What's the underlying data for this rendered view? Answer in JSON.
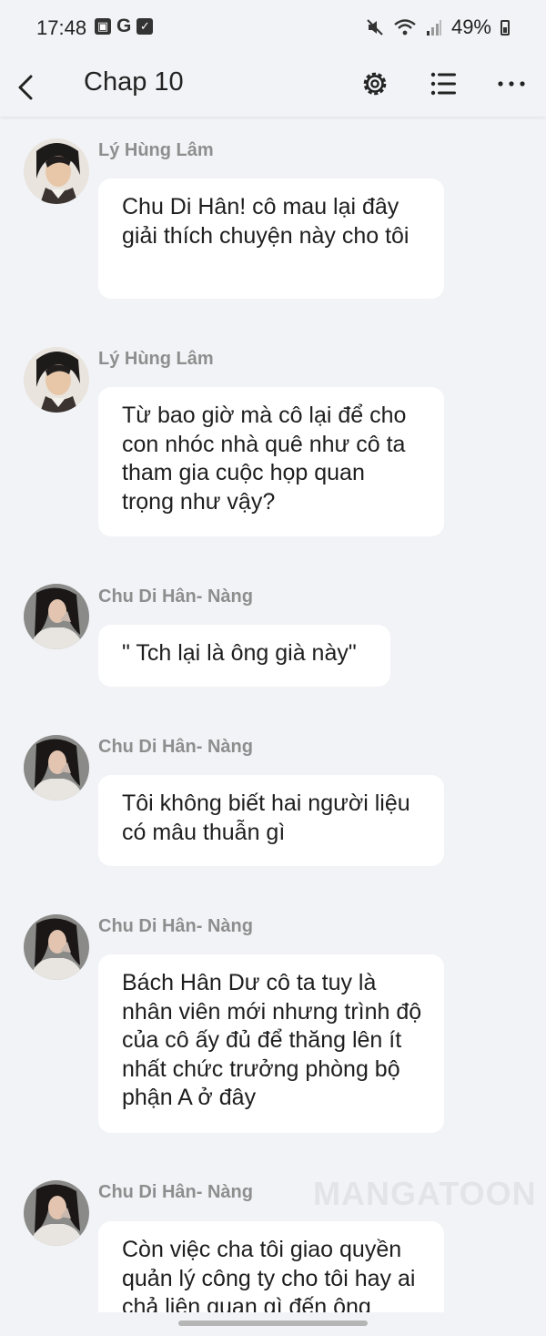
{
  "status_bar": {
    "time": "17:48",
    "app_icon_g": "G",
    "battery": "49%"
  },
  "header": {
    "title": "Chap 10",
    "icons": [
      "back-arrow-icon",
      "gear-icon",
      "list-icon",
      "more-icon"
    ]
  },
  "messages": [
    {
      "name": "Lý Hùng Lâm",
      "text": "Chu Di Hân! cô mau lại đây giải thích chuyện này cho tôi"
    },
    {
      "name": "Lý Hùng Lâm",
      "text": "Từ bao giờ mà cô lại để cho con nhóc nhà quê như cô ta tham gia cuộc họp quan trọng như vậy?"
    },
    {
      "name": "Chu Di Hân- Nàng",
      "text": "\" Tch lại là ông già này\""
    },
    {
      "name": "Chu Di Hân- Nàng",
      "text": "Tôi không biết hai người liệu có mâu thuẫn gì"
    },
    {
      "name": "Chu Di Hân- Nàng",
      "text": "Bách Hân Dư cô ta tuy là nhân viên mới nhưng trình độ của cô ấy đủ để thăng lên ít nhất chức trưởng phòng bộ phận A ở đây"
    },
    {
      "name": "Chu Di Hân- Nàng",
      "text": "Còn việc cha tôi giao quyền quản lý công ty cho tôi hay ai chả liên quan gì đến ông"
    }
  ],
  "watermark": "MANGATOON",
  "colors": {
    "background": "#f2f3f7",
    "bubble": "#ffffff",
    "name": "#8e8e8e"
  }
}
